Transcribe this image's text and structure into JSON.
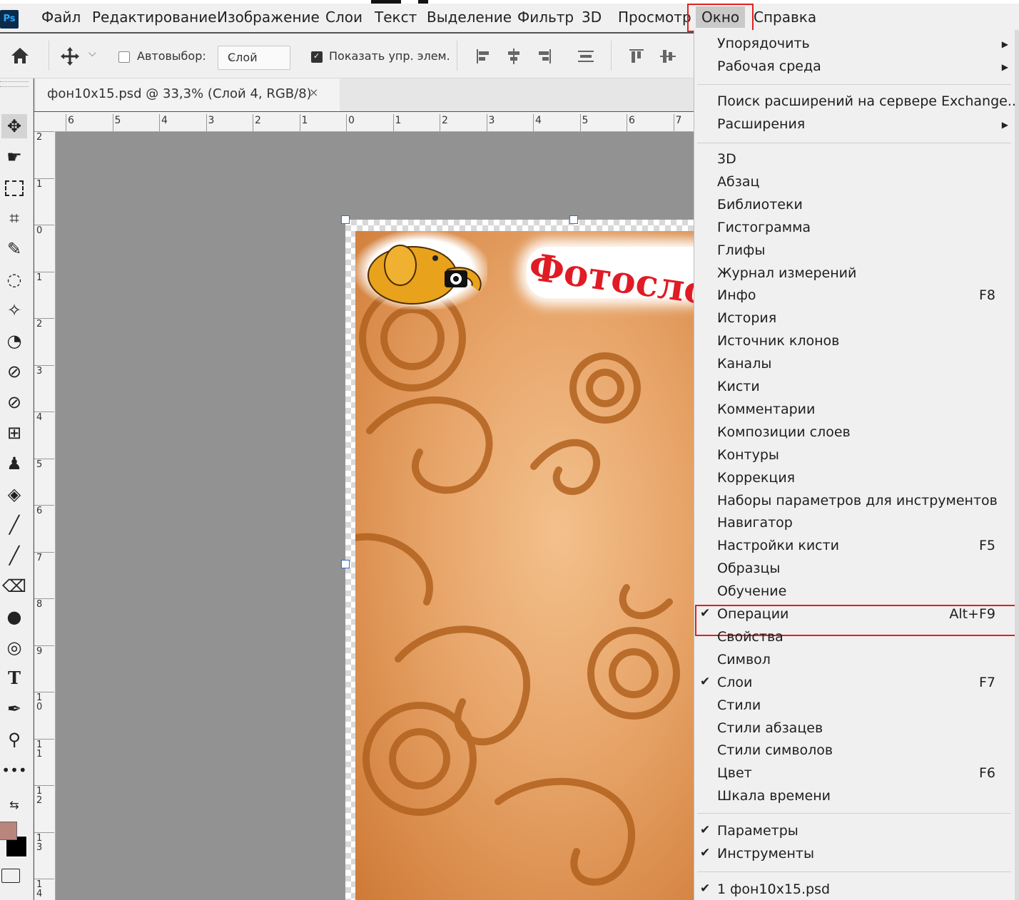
{
  "app": {
    "logo": "Ps"
  },
  "menubar": {
    "items": [
      "Файл",
      "Редактирование",
      "Изображение",
      "Слои",
      "Текст",
      "Выделение",
      "Фильтр",
      "3D",
      "Просмотр",
      "Окно",
      "Справка"
    ]
  },
  "options": {
    "autoselect_label": "Автовыбор:",
    "layer_select_value": "Слой",
    "show_controls_label": "Показать упр. элем."
  },
  "document": {
    "tab_title": "фон10x15.psd @ 33,3% (Слой 4, RGB/8)",
    "close_glyph": "×",
    "art_text": "Фотосло"
  },
  "rulers": {
    "h_labels": [
      "6",
      "5",
      "4",
      "3",
      "2",
      "1",
      "0",
      "1",
      "2",
      "3",
      "4",
      "5",
      "6",
      "7"
    ],
    "v_labels": [
      "2",
      "1",
      "0",
      "1",
      "2",
      "3",
      "4",
      "5",
      "6",
      "7",
      "8",
      "9",
      "1 0",
      "1 1",
      "1 2",
      "1 3",
      "1 4"
    ]
  },
  "window_menu": {
    "group1": [
      {
        "label": "Упорядочить",
        "submenu": true
      },
      {
        "label": "Рабочая среда",
        "submenu": true
      }
    ],
    "group2": [
      {
        "label": "Поиск расширений на сервере Exchange...",
        "submenu": false
      },
      {
        "label": "Расширения",
        "submenu": true
      }
    ],
    "group3": [
      {
        "label": "3D",
        "shortcut": "",
        "checked": false
      },
      {
        "label": "Абзац",
        "shortcut": "",
        "checked": false
      },
      {
        "label": "Библиотеки",
        "shortcut": "",
        "checked": false
      },
      {
        "label": "Гистограмма",
        "shortcut": "",
        "checked": false
      },
      {
        "label": "Глифы",
        "shortcut": "",
        "checked": false
      },
      {
        "label": "Журнал измерений",
        "shortcut": "",
        "checked": false
      },
      {
        "label": "Инфо",
        "shortcut": "F8",
        "checked": false
      },
      {
        "label": "История",
        "shortcut": "",
        "checked": false
      },
      {
        "label": "Источник клонов",
        "shortcut": "",
        "checked": false
      },
      {
        "label": "Каналы",
        "shortcut": "",
        "checked": false
      },
      {
        "label": "Кисти",
        "shortcut": "",
        "checked": false
      },
      {
        "label": "Комментарии",
        "shortcut": "",
        "checked": false
      },
      {
        "label": "Композиции слоев",
        "shortcut": "",
        "checked": false
      },
      {
        "label": "Контуры",
        "shortcut": "",
        "checked": false
      },
      {
        "label": "Коррекция",
        "shortcut": "",
        "checked": false
      },
      {
        "label": "Наборы параметров для инструментов",
        "shortcut": "",
        "checked": false
      },
      {
        "label": "Навигатор",
        "shortcut": "",
        "checked": false
      },
      {
        "label": "Настройки кисти",
        "shortcut": "F5",
        "checked": false
      },
      {
        "label": "Образцы",
        "shortcut": "",
        "checked": false
      },
      {
        "label": "Обучение",
        "shortcut": "",
        "checked": false
      },
      {
        "label": "Операции",
        "shortcut": "Alt+F9",
        "checked": true,
        "highlighted": true
      },
      {
        "label": "Свойства",
        "shortcut": "",
        "checked": false
      },
      {
        "label": "Символ",
        "shortcut": "",
        "checked": false
      },
      {
        "label": "Слои",
        "shortcut": "F7",
        "checked": true
      },
      {
        "label": "Стили",
        "shortcut": "",
        "checked": false
      },
      {
        "label": "Стили абзацев",
        "shortcut": "",
        "checked": false
      },
      {
        "label": "Стили символов",
        "shortcut": "",
        "checked": false
      },
      {
        "label": "Цвет",
        "shortcut": "F6",
        "checked": false
      },
      {
        "label": "Шкала времени",
        "shortcut": "",
        "checked": false
      }
    ],
    "group4": [
      {
        "label": "Параметры",
        "checked": true
      },
      {
        "label": "Инструменты",
        "checked": true
      }
    ],
    "group5": [
      {
        "label": "1 фон10x15.psd",
        "checked": true
      }
    ]
  },
  "colors": {
    "highlight_red": "#e02020",
    "foreground_swatch": "#b8867c",
    "background_swatch": "#000000"
  }
}
